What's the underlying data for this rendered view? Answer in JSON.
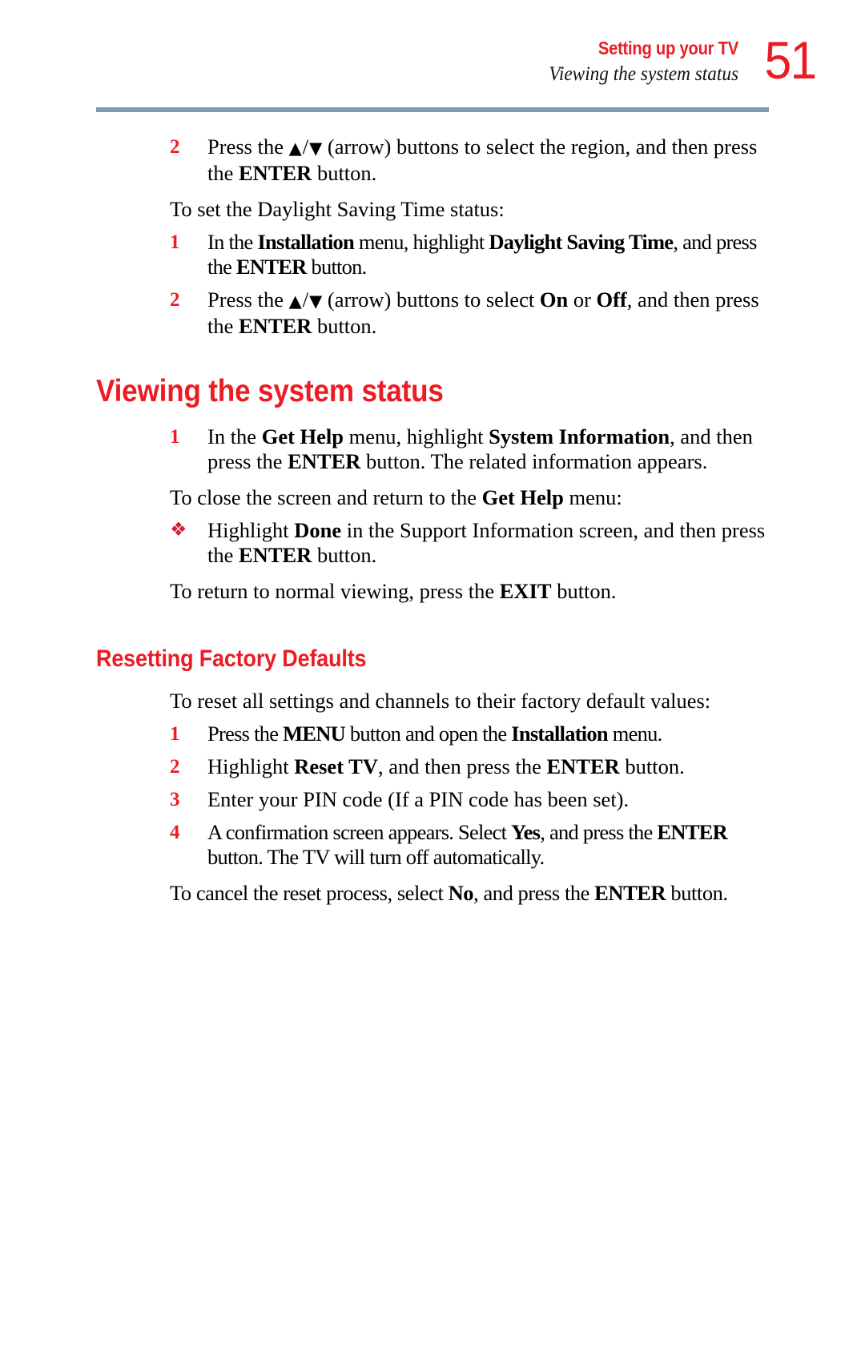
{
  "header": {
    "title": "Setting up your TV",
    "subtitle": "Viewing the system status",
    "page_number": "51",
    "title_color": "#ec1c24",
    "rule_color": "#7e9bb5"
  },
  "body": {
    "step_region": {
      "marker": "2",
      "text_1": "Press the ",
      "arrow_up": "▲",
      "slash": "/",
      "arrow_down": "▼",
      "text_2": " (arrow) buttons to select the region, and then press the ",
      "bold_enter": "ENTER",
      "text_3": " button."
    },
    "lead_dst": "To set the Daylight Saving Time status:",
    "step_dst_1": {
      "marker": "1",
      "text_1": "In the ",
      "bold_installation": "Installation",
      "text_2": " menu, highlight ",
      "bold_dst": "Daylight Saving Time",
      "text_3": ", and press the ",
      "bold_enter": "ENTER",
      "text_4": " button."
    },
    "step_dst_2": {
      "marker": "2",
      "text_1": "Press the ",
      "arrow_up": "▲",
      "slash": "/",
      "arrow_down": "▼",
      "text_2": " (arrow) buttons to select ",
      "bold_on": "On",
      "text_3": " or ",
      "bold_off": "Off",
      "text_4": ", and then press the ",
      "bold_enter": "ENTER",
      "text_5": " button."
    },
    "heading_viewing": "Viewing the system status",
    "step_view_1": {
      "marker": "1",
      "text_1": "In the ",
      "bold_gethelp": "Get Help",
      "text_2": " menu, highlight ",
      "bold_sysinfo": "System Information",
      "text_3": ", and then press the ",
      "bold_enter": "ENTER",
      "text_4": " button. The related information appears."
    },
    "lead_close": {
      "text_1": "To close the screen and return to the ",
      "bold_gethelp": "Get Help",
      "text_2": " menu:"
    },
    "step_done": {
      "marker": "❖",
      "text_1": "Highlight ",
      "bold_done": "Done",
      "text_2": " in the Support Information screen, and then press the ",
      "bold_enter": "ENTER",
      "text_3": " button."
    },
    "lead_exit": {
      "text_1": "To return to normal viewing, press the ",
      "bold_exit": "EXIT",
      "text_2": " button."
    },
    "heading_resetting": "Resetting Factory Defaults",
    "lead_reset": "To reset all settings and channels to their factory default values:",
    "step_reset_1": {
      "marker": "1",
      "text_1": "Press the ",
      "bold_menu": "MENU",
      "text_2": " button and open the ",
      "bold_installation": "Installation",
      "text_3": " menu."
    },
    "step_reset_2": {
      "marker": "2",
      "text_1": "Highlight ",
      "bold_resettv": "Reset TV",
      "text_2": ", and then press the ",
      "bold_enter": "ENTER",
      "text_3": " button."
    },
    "step_reset_3": {
      "marker": "3",
      "text_1": "Enter your PIN code (If a PIN code has been set)."
    },
    "step_reset_4": {
      "marker": "4",
      "text_1": "A confirmation screen appears. Select ",
      "bold_yes": "Yes",
      "text_2": ", and press the ",
      "bold_enter": "ENTER",
      "text_3": " button. The TV will turn off automatically."
    },
    "lead_cancel": {
      "text_1": "To cancel the reset process, select ",
      "bold_no": "No",
      "text_2": ", and press the ",
      "bold_enter": "ENTER",
      "text_3": " button."
    }
  }
}
